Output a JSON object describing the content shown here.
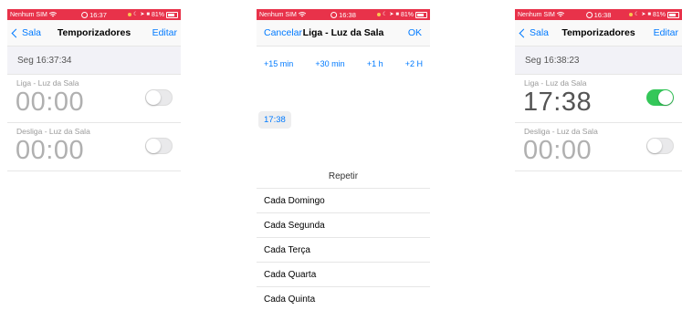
{
  "status_bars": {
    "p1": {
      "carrier": "Nenhum SIM",
      "time": "16:37",
      "battery": "81%"
    },
    "p2": {
      "carrier": "Nenhum SIM",
      "time": "16:38",
      "battery": "81%"
    },
    "p3": {
      "carrier": "Nenhum SIM",
      "time": "16:38",
      "battery": "81%"
    }
  },
  "screen1": {
    "back_label": "Sala",
    "title": "Temporizadores",
    "right_label": "Editar",
    "day": "Seg 16:37:34",
    "timers": [
      {
        "label": "Liga - Luz da Sala",
        "time": "00:00",
        "enabled": false
      },
      {
        "label": "Desliga - Luz da Sala",
        "time": "00:00",
        "enabled": false
      }
    ]
  },
  "screen2": {
    "cancel_label": "Cancelar",
    "title": "Liga - Luz da Sala",
    "ok_label": "OK",
    "quick_buttons": [
      "+15 min",
      "+30 min",
      "+1 h",
      "+2 H"
    ],
    "selected_time": "17:38",
    "repeat_header": "Repetir",
    "repeat_options": [
      "Cada Domingo",
      "Cada Segunda",
      "Cada Terça",
      "Cada Quarta",
      "Cada Quinta"
    ]
  },
  "screen3": {
    "back_label": "Sala",
    "title": "Temporizadores",
    "right_label": "Editar",
    "day": "Seg 16:38:23",
    "timers": [
      {
        "label": "Liga - Luz da Sala",
        "time": "17:38",
        "enabled": true
      },
      {
        "label": "Desliga - Luz da Sala",
        "time": "00:00",
        "enabled": false
      }
    ]
  },
  "colors": {
    "accent": "#007aff",
    "status_bar": "#e8324a",
    "toggle_on": "#34c759"
  }
}
